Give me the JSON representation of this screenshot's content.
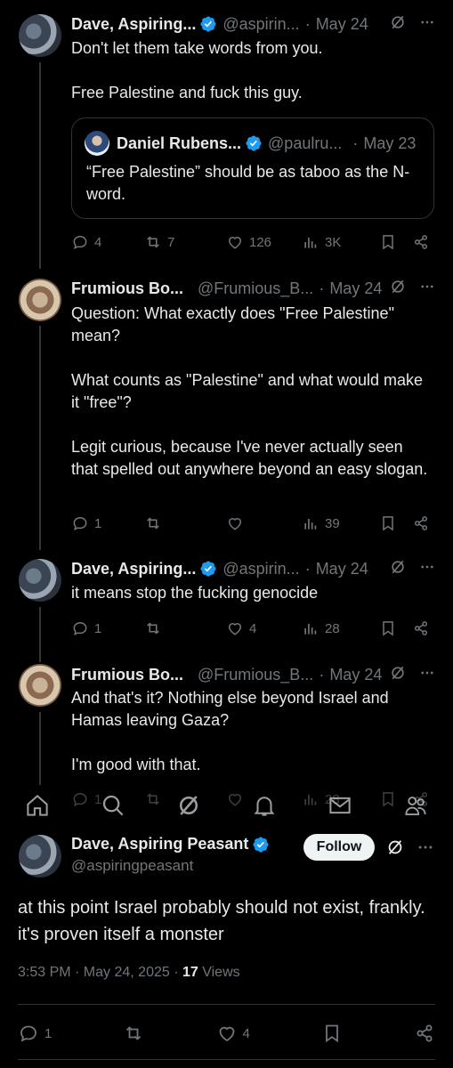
{
  "tweets": [
    {
      "name": "Dave, Aspiring...",
      "handle": "@aspirin...",
      "sep": "·",
      "date": "May 24",
      "lines": [
        "Don't let them take words from you.",
        "Free Palestine and fuck this guy."
      ],
      "quote": {
        "name": "Daniel Rubens...",
        "handle": "@paulru...",
        "sep": "·",
        "date": "May 23",
        "text": "“Free Palestine” should be as taboo as the N-word."
      },
      "replies": "4",
      "reposts": "7",
      "likes": "126",
      "views": "3K"
    },
    {
      "name": "Frumious Bo...",
      "handle": "@Frumious_B...",
      "sep": "·",
      "date": "May 24",
      "lines": [
        "Question: What exactly does \"Free Palestine\" mean?",
        "What counts as \"Palestine\" and what would make it \"free\"?",
        "Legit curious, because I've never actually seen that spelled out anywhere beyond an easy slogan."
      ],
      "replies": "1",
      "reposts": "",
      "likes": "",
      "views": "39"
    },
    {
      "name": "Dave, Aspiring...",
      "handle": "@aspirin...",
      "sep": "·",
      "date": "May 24",
      "lines": [
        "it means stop the fucking genocide"
      ],
      "replies": "1",
      "reposts": "",
      "likes": "4",
      "views": "28"
    },
    {
      "name": "Frumious Bo...",
      "handle": "@Frumious_B...",
      "sep": "·",
      "date": "May 24",
      "lines": [
        "And that's it? Nothing else beyond Israel and Hamas leaving Gaza?",
        "I'm good with that."
      ],
      "replies": "1",
      "reposts": "",
      "likes": "",
      "views": "28"
    }
  ],
  "main_tweet": {
    "name": "Dave, Aspiring Peasant",
    "handle": "@aspiringpeasant",
    "follow_label": "Follow",
    "text": "at this point Israel probably should not exist, frankly. it's proven itself a monster",
    "time": "3:53 PM · May 24, 2025 · ",
    "views_count": "17",
    "views_label": " Views",
    "replies": "1",
    "likes": "4"
  },
  "icons": {
    "verified": "verified-badge-icon",
    "grok": "grok-icon",
    "more": "more-icon",
    "reply": "reply-icon",
    "repost": "repost-icon",
    "like": "like-icon",
    "views": "views-icon",
    "bookmark": "bookmark-icon",
    "share": "share-icon"
  },
  "colors": {
    "accent": "#1d9bf0",
    "muted": "#71767b",
    "text": "#e7e9ea",
    "background": "#000000"
  }
}
